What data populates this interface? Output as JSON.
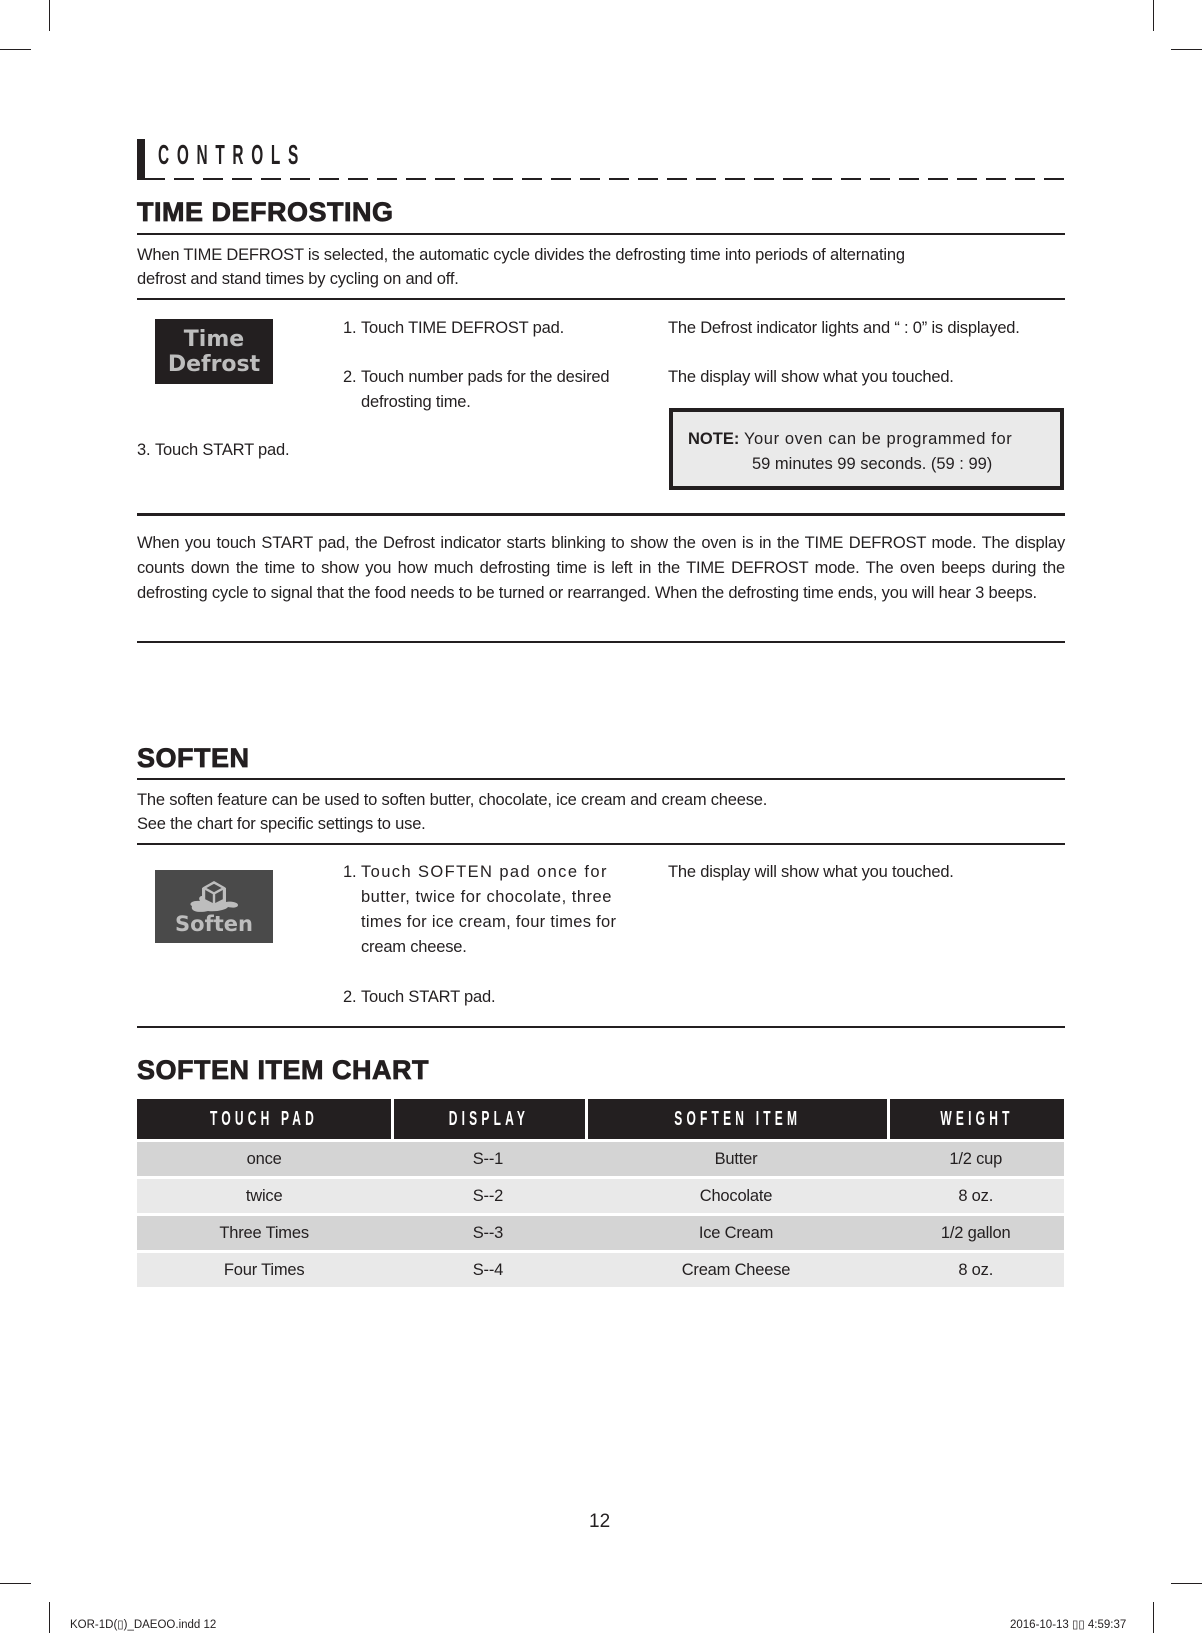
{
  "header": {
    "section_label": "CONTROLS"
  },
  "time_defrosting": {
    "title": "TIME DEFROSTING",
    "intro_line1": "When TIME DEFROST is selected, the automatic cycle divides the defrosting time into periods of alternating",
    "intro_line2": "defrost and stand times by cycling on and off.",
    "pad_icon": {
      "name": "time-defrost-pad",
      "line1": "Time",
      "line2": "Defrost"
    },
    "steps": [
      {
        "num": "1.",
        "text": "Touch TIME DEFROST pad.",
        "result": "The Defrost indicator lights and “ : 0” is displayed."
      },
      {
        "num": "2.",
        "text_line1": "Touch number pads for the desired",
        "text_line2": "defrosting time.",
        "result": "The display will show what you touched."
      },
      {
        "num": "3.",
        "text": "Touch START pad."
      }
    ],
    "note": {
      "label": "NOTE:",
      "line1": "Your oven can be programmed for",
      "line2": "59 minutes 99 seconds. (59 : 99)"
    },
    "description": "When you touch START pad, the Defrost indicator starts blinking to show the oven is in the TIME DEFROST mode. The display counts down the time to show you how much defrosting time is left in the TIME DEFROST mode. The oven beeps during the defrosting cycle to signal that the food needs to be turned or rearranged. When the defrosting time ends, you will hear 3 beeps."
  },
  "soften": {
    "title": "SOFTEN",
    "intro_line1": "The soften feature can be used to soften butter, chocolate, ice cream and cream cheese.",
    "intro_line2": "See the chart for specific settings to use.",
    "pad_icon": {
      "name": "soften-pad",
      "label": "Soften",
      "icon": "melting-cube-icon"
    },
    "steps": [
      {
        "num": "1.",
        "lines": [
          "Touch SOFTEN pad once for",
          "butter, twice for chocolate, three",
          "times for ice cream, four times for",
          "cream cheese."
        ],
        "result": "The display will show what you touched."
      },
      {
        "num": "2.",
        "text": "Touch START pad."
      }
    ]
  },
  "chart": {
    "title": "SOFTEN ITEM CHART",
    "headers": [
      "TOUCH PAD",
      "DISPLAY",
      "SOFTEN ITEM",
      "WEIGHT"
    ],
    "rows": [
      [
        "once",
        "S--1",
        "Butter",
        "1/2 cup"
      ],
      [
        "twice",
        "S--2",
        "Chocolate",
        "8 oz."
      ],
      [
        "Three Times",
        "S--3",
        "Ice Cream",
        "1/2 gallon"
      ],
      [
        "Four Times",
        "S--4",
        "Cream Cheese",
        "8 oz."
      ]
    ]
  },
  "footer": {
    "page_number": "12",
    "slug_left": "KOR-1D(▯)_DAEOO.indd   12",
    "slug_right": "2016-10-13   ▯▯ 4:59:37"
  }
}
